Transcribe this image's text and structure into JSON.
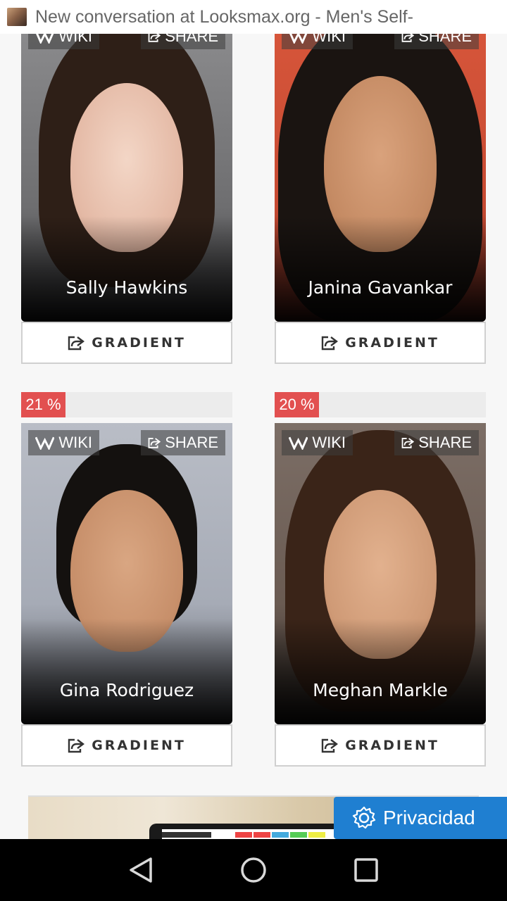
{
  "window": {
    "title": "New conversation at Looksmax.org - Men's Self-"
  },
  "labels": {
    "wiki": "WIKI",
    "share": "SHARE",
    "gradient": "GRADIENT"
  },
  "cards": [
    {
      "name": "Sally Hawkins"
    },
    {
      "name": "Janina Gavankar"
    },
    {
      "name": "Gina Rodriguez",
      "percent": "21 %",
      "percent_value": 21
    },
    {
      "name": "Meghan Markle",
      "percent": "20 %",
      "percent_value": 20
    }
  ],
  "privacy": {
    "label": "Privacidad"
  },
  "colors": {
    "badge_red": "#e25050",
    "privacy_blue": "#1f7fd1"
  },
  "icons": [
    "wikipedia-icon",
    "share-icon",
    "gear-icon",
    "back-icon",
    "home-icon",
    "recents-icon"
  ]
}
